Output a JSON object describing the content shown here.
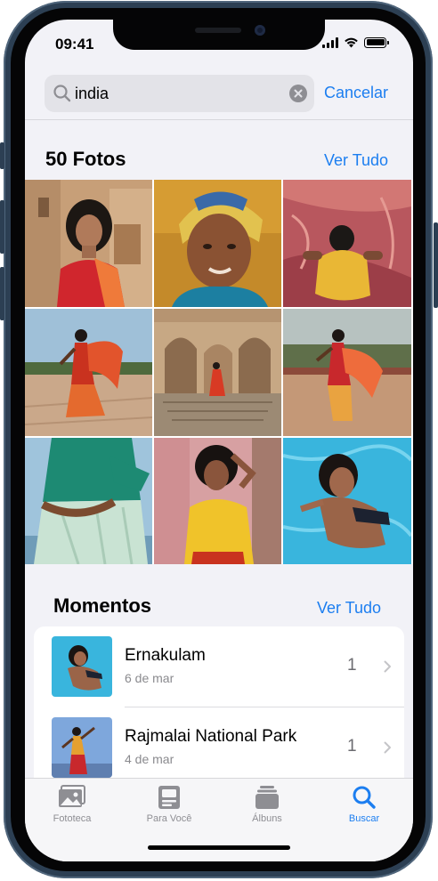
{
  "status_bar": {
    "time": "09:41"
  },
  "search": {
    "query": "india",
    "cancel_label": "Cancelar"
  },
  "photos_section": {
    "title": "50 Fotos",
    "see_all_label": "Ver Tudo"
  },
  "moments_section": {
    "title": "Momentos",
    "see_all_label": "Ver Tudo",
    "items": [
      {
        "name": "Ernakulam",
        "date": "6 de mar",
        "count": "1"
      },
      {
        "name": "Rajmalai National Park",
        "date": "4 de mar",
        "count": "1"
      }
    ]
  },
  "tab_bar": {
    "tabs": [
      {
        "label": "Fototeca",
        "icon": "photos-icon"
      },
      {
        "label": "Para Você",
        "icon": "for-you-icon"
      },
      {
        "label": "Álbuns",
        "icon": "albums-icon"
      },
      {
        "label": "Buscar",
        "icon": "search-icon",
        "active": true
      }
    ]
  },
  "colors": {
    "accent": "#1c7ef0",
    "background": "#f2f2f7"
  }
}
